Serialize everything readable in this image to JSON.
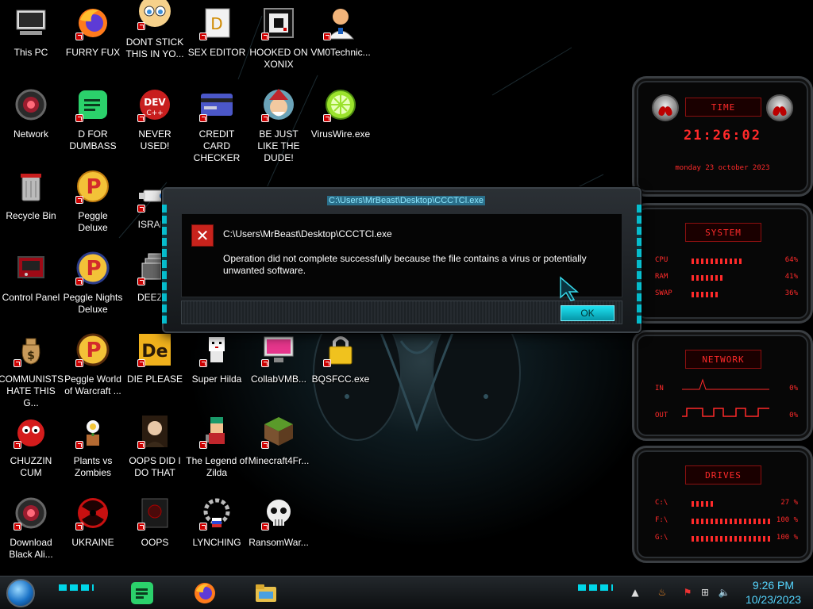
{
  "desktop": {
    "icons": [
      {
        "label": "This PC",
        "icon": "pc-icon"
      },
      {
        "label": "FURRY FUX",
        "icon": "firefox-icon"
      },
      {
        "label": "DONT STICK THIS IN YO...",
        "icon": "anime-face-icon"
      },
      {
        "label": "SEX EDITOR",
        "icon": "editor-icon"
      },
      {
        "label": "HOOKED ON XONIX",
        "icon": "xonix-game-icon"
      },
      {
        "label": "VM0Technic...",
        "icon": "doctor-icon"
      },
      {
        "label": "Network",
        "icon": "network-alien-icon"
      },
      {
        "label": "D FOR DUMBASS",
        "icon": "green-chat-icon"
      },
      {
        "label": "NEVER USED!",
        "icon": "dev-cpp-icon"
      },
      {
        "label": "CREDIT CARD CHECKER",
        "icon": "credit-card-icon"
      },
      {
        "label": "BE JUST LIKE THE DUDE!",
        "icon": "elf-icon"
      },
      {
        "label": "VirusWire.exe",
        "icon": "lime-icon"
      },
      {
        "label": "Recycle Bin",
        "icon": "recycle-bin-icon"
      },
      {
        "label": "Peggle Deluxe",
        "icon": "peggle-icon"
      },
      {
        "label": "ISRAEL",
        "icon": "usb-icon"
      },
      {
        "label": "Control Panel",
        "icon": "control-panel-icon"
      },
      {
        "label": "Peggle Nights Deluxe",
        "icon": "peggle-nights-icon"
      },
      {
        "label": "DEEZ N",
        "icon": "windows-stack-icon"
      },
      {
        "label": "COMMUNISTS HATE THIS G...",
        "icon": "money-bag-icon"
      },
      {
        "label": "Peggle World of Warcraft ...",
        "icon": "peggle-wow-icon"
      },
      {
        "label": "DIE PLEASE",
        "icon": "de-icon"
      },
      {
        "label": "Super Hilda",
        "icon": "pixel-character-icon"
      },
      {
        "label": "CollabVMB...",
        "icon": "monitor-icon"
      },
      {
        "label": "BQSFCC.exe",
        "icon": "lock-icon"
      },
      {
        "label": "CHUZZIN CUM",
        "icon": "chuzzle-icon"
      },
      {
        "label": "Plants vs Zombies",
        "icon": "flower-pot-icon"
      },
      {
        "label": "OOPS DID I DO THAT",
        "icon": "portrait-icon"
      },
      {
        "label": "The Legend of Zilda",
        "icon": "pixel-hero-icon"
      },
      {
        "label": "Minecraft4Fr...",
        "icon": "grass-block-icon"
      },
      {
        "label": "Download Black Ali...",
        "icon": "alien-download-icon"
      },
      {
        "label": "UKRAINE",
        "icon": "radiation-icon"
      },
      {
        "label": "OOPS",
        "icon": "dark-screen-icon"
      },
      {
        "label": "LYNCHING",
        "icon": "gear-flag-icon"
      },
      {
        "label": "RansomWar...",
        "icon": "skull-icon"
      }
    ]
  },
  "dialog": {
    "title": "C:\\Users\\MrBeast\\Desktop\\CCCTCl.exe",
    "heading": "C:\\Users\\MrBeast\\Desktop\\CCCTCl.exe",
    "message": "Operation did not complete successfully because the file contains a virus or potentially unwanted software.",
    "ok_label": "OK",
    "icon": "error-icon"
  },
  "widgets": {
    "time": {
      "title": "TIME",
      "clock": "21:26:02",
      "date": "monday 23 october 2023"
    },
    "system": {
      "title": "SYSTEM",
      "rows": [
        {
          "key": "CPU",
          "value": "64%",
          "level": 0.64
        },
        {
          "key": "RAM",
          "value": "41%",
          "level": 0.41
        },
        {
          "key": "SWAP",
          "value": "36%",
          "level": 0.36
        }
      ]
    },
    "network": {
      "title": "NETWORK",
      "rows": [
        {
          "key": "IN",
          "value": "0%"
        },
        {
          "key": "OUT",
          "value": "0%"
        }
      ]
    },
    "drives": {
      "title": "DRIVES",
      "rows": [
        {
          "key": "C:\\",
          "value": "27 %",
          "level": 0.27
        },
        {
          "key": "F:\\",
          "value": "100 %",
          "level": 1.0
        },
        {
          "key": "G:\\",
          "value": "100 %",
          "level": 1.0
        }
      ]
    }
  },
  "taskbar": {
    "apps": [
      "chat-app-icon",
      "firefox-icon",
      "file-explorer-icon"
    ],
    "tray": [
      "up-arrow-icon",
      "java-icon",
      "flag-icon",
      "network-icon",
      "volume-icon"
    ],
    "time": "9:26 PM",
    "date": "10/23/2023"
  },
  "colors": {
    "accent": "#00d6e8",
    "widget_red": "#ff2a2a",
    "error_red": "#c8231c",
    "clock_blue": "#55d6ff"
  }
}
